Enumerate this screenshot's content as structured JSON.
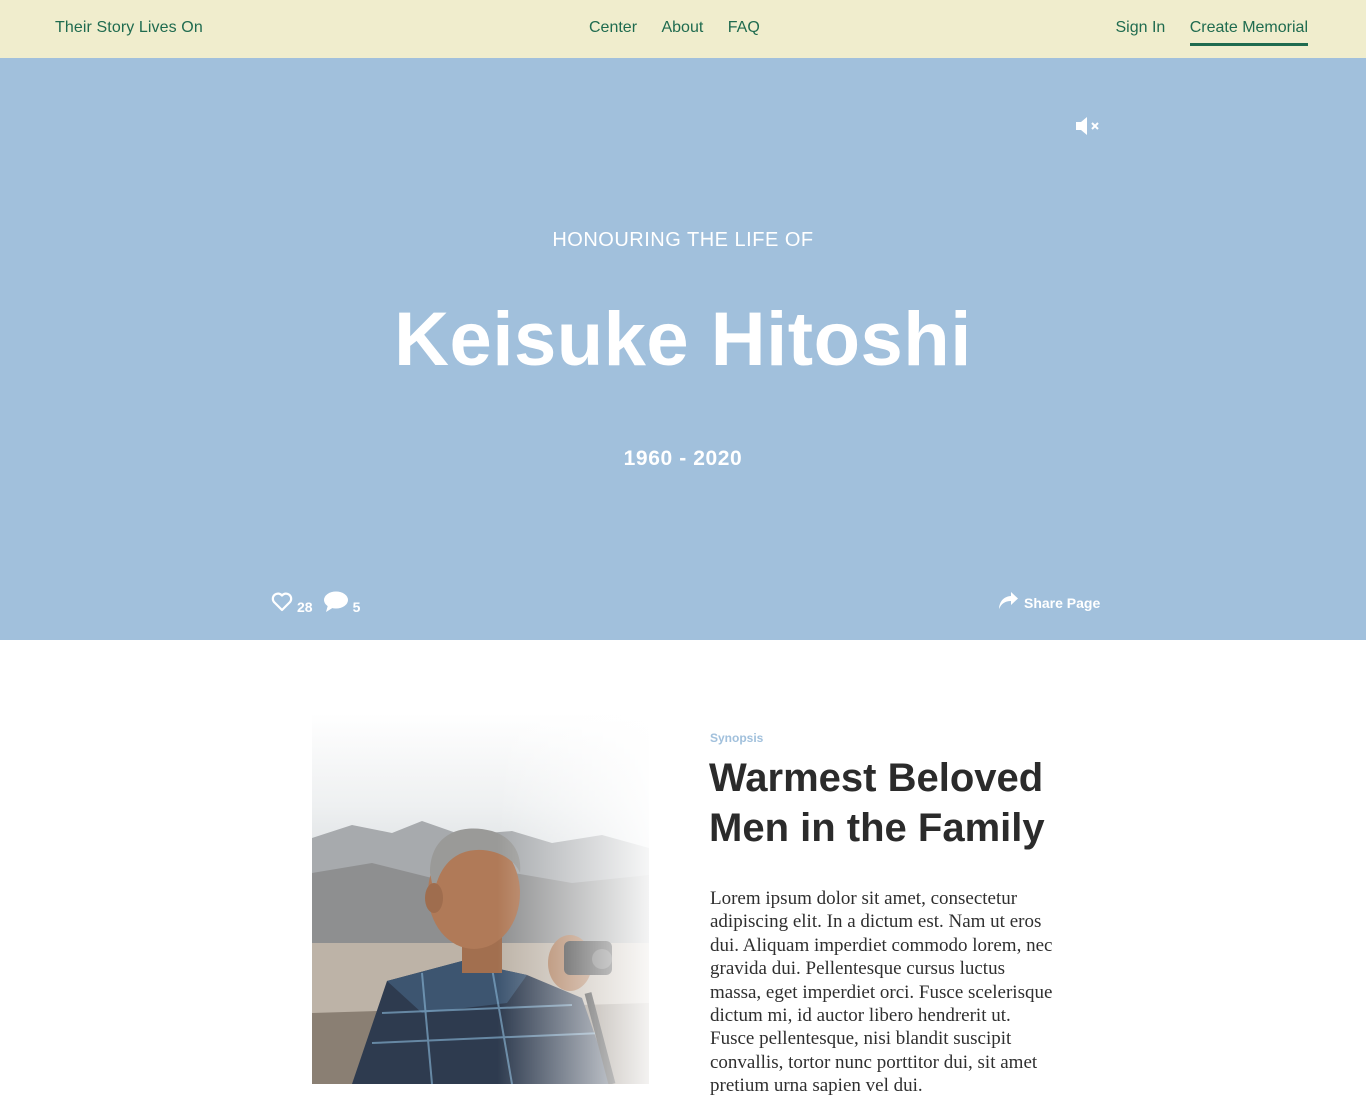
{
  "nav": {
    "brand": "Their Story Lives On",
    "links": [
      "Center",
      "About",
      "FAQ"
    ],
    "sign_in": "Sign In",
    "create": "Create Memorial"
  },
  "hero": {
    "mute_icon": "speaker-muted-icon",
    "eyebrow": "HONOURING THE LIFE OF",
    "name": "Keisuke Hitoshi",
    "years": "1960 - 2020",
    "likes": "28",
    "comments": "5",
    "share_label": "Share Page"
  },
  "synopsis": {
    "label": "Synopsis",
    "title": "Warmest Beloved Men in the Family",
    "body": "Lorem ipsum dolor sit amet, consectetur adipiscing elit. In a dictum est. Nam ut eros dui. Aliquam imperdiet commodo lorem, nec gravida dui. Pellentesque cursus luctus massa, eget imperdiet orci. Fusce scelerisque dictum mi, id auctor libero hendrerit ut. Fusce pellentesque, nisi blandit suscipit convallis, tortor nunc porttitor dui, sit amet pretium urna sapien vel dui."
  },
  "colors": {
    "nav_bg": "#f0edcd",
    "nav_text": "#1f6b4f",
    "hero_bg": "#a1c0dc",
    "heading": "#2b2b2b"
  }
}
